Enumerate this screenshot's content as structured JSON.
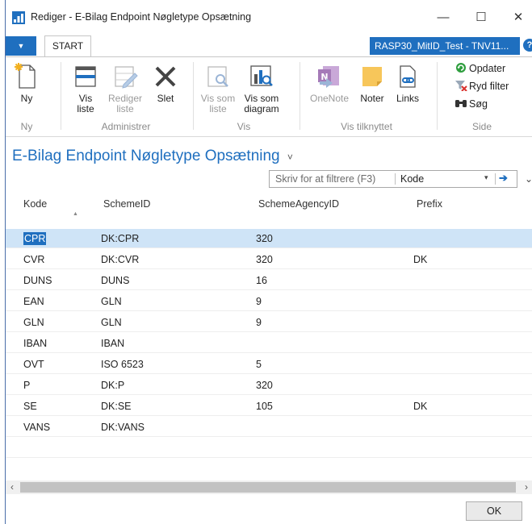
{
  "window": {
    "title": "Rediger - E-Bilag Endpoint Nøgletype Opsætning",
    "controls": {
      "minimize": "—",
      "maximize": "☐",
      "close": "✕"
    }
  },
  "ribbon": {
    "app_menu_glyph": "▼",
    "tab_start": "START",
    "company": "RASP30_MitID_Test - TNV11...",
    "help": "?",
    "buttons": {
      "ny": "Ny",
      "vis_liste_1": "Vis",
      "vis_liste_2": "liste",
      "rediger_liste_1": "Rediger",
      "rediger_liste_2": "liste",
      "slet": "Slet",
      "vis_som_liste_1": "Vis som",
      "vis_som_liste_2": "liste",
      "vis_som_diagram_1": "Vis som",
      "vis_som_diagram_2": "diagram",
      "onenote": "OneNote",
      "noter": "Noter",
      "links": "Links",
      "opdater": "Opdater",
      "ryd_filter": "Ryd filter",
      "soeg": "Søg"
    },
    "groups": {
      "ny": "Ny",
      "administrer": "Administrer",
      "vis": "Vis",
      "vis_tilknyttet": "Vis tilknyttet",
      "side": "Side"
    }
  },
  "page": {
    "title": "E-Bilag Endpoint Nøgletype Opsætning",
    "title_chevron": "˅"
  },
  "filter": {
    "placeholder": "Skriv for at filtrere (F3)",
    "field": "Kode",
    "dropdown_glyph": "▾",
    "go_glyph": "➔",
    "expand_glyph": "⌄"
  },
  "grid": {
    "columns": [
      "Kode",
      "SchemeID",
      "SchemeAgencyID",
      "Prefix"
    ],
    "sort_indicator": "▲",
    "rows": [
      {
        "kode": "CPR",
        "scheme_id": "DK:CPR",
        "agency": "320",
        "prefix": ""
      },
      {
        "kode": "CVR",
        "scheme_id": "DK:CVR",
        "agency": "320",
        "prefix": "DK"
      },
      {
        "kode": "DUNS",
        "scheme_id": "DUNS",
        "agency": "16",
        "prefix": ""
      },
      {
        "kode": "EAN",
        "scheme_id": "GLN",
        "agency": "9",
        "prefix": ""
      },
      {
        "kode": "GLN",
        "scheme_id": "GLN",
        "agency": "9",
        "prefix": ""
      },
      {
        "kode": "IBAN",
        "scheme_id": "IBAN",
        "agency": "",
        "prefix": ""
      },
      {
        "kode": "OVT",
        "scheme_id": "ISO 6523",
        "agency": "5",
        "prefix": ""
      },
      {
        "kode": "P",
        "scheme_id": "DK:P",
        "agency": "320",
        "prefix": ""
      },
      {
        "kode": "SE",
        "scheme_id": "DK:SE",
        "agency": "105",
        "prefix": "DK"
      },
      {
        "kode": "VANS",
        "scheme_id": "DK:VANS",
        "agency": "",
        "prefix": ""
      }
    ],
    "selected_row": "CPR"
  },
  "scrollbar": {
    "left": "‹",
    "right": "›"
  },
  "footer": {
    "ok": "OK"
  },
  "colors": {
    "accent": "#1f6fbf",
    "selection": "#cfe4f7"
  }
}
